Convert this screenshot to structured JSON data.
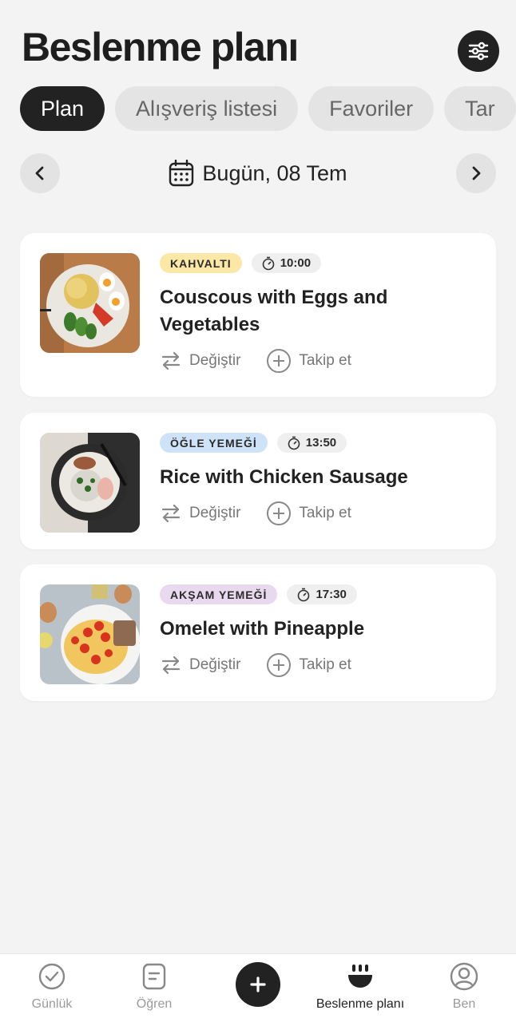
{
  "header": {
    "title": "Beslenme planı",
    "filter_icon": "sliders-icon"
  },
  "tabs": [
    {
      "label": "Plan",
      "active": true
    },
    {
      "label": "Alışveriş listesi",
      "active": false
    },
    {
      "label": "Favoriler",
      "active": false
    },
    {
      "label": "Tar",
      "active": false
    }
  ],
  "date_nav": {
    "label": "Bugün, 08 Tem",
    "prev_icon": "chevron-left-icon",
    "next_icon": "chevron-right-icon",
    "calendar_icon": "calendar-icon"
  },
  "meals": [
    {
      "badge": "KAHVALTI",
      "badge_color": "#fbe7a6",
      "time": "10:00",
      "title": "Couscous with Eggs and Vegetables",
      "change_label": "Değiştir",
      "track_label": "Takip et"
    },
    {
      "badge": "ÖĞLE YEMEĞİ",
      "badge_color": "#cfe3f8",
      "time": "13:50",
      "title": "Rice with Chicken Sausage",
      "change_label": "Değiştir",
      "track_label": "Takip et"
    },
    {
      "badge": "AKŞAM YEMEĞİ",
      "badge_color": "#e9d9ee",
      "time": "17:30",
      "title": "Omelet with Pineapple",
      "change_label": "Değiştir",
      "track_label": "Takip et"
    }
  ],
  "bottom_nav": {
    "items": [
      {
        "label": "Günlük",
        "icon": "check-circle-icon",
        "active": false
      },
      {
        "label": "Öğren",
        "icon": "document-icon",
        "active": false
      },
      {
        "label": "Beslenme planı",
        "icon": "bowl-icon",
        "active": true
      },
      {
        "label": "Ben",
        "icon": "profile-icon",
        "active": false
      }
    ],
    "add_icon": "plus-icon"
  },
  "colors": {
    "accent": "#222222",
    "background": "#f3f3f3"
  }
}
